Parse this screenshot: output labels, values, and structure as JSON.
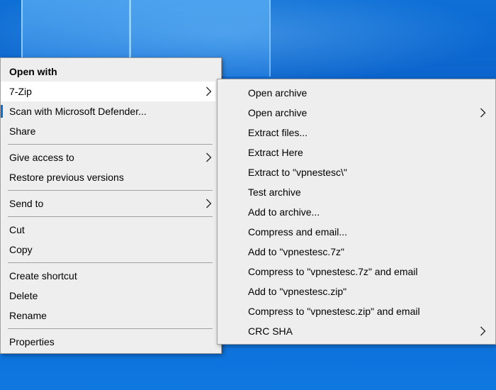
{
  "main_menu": {
    "items": [
      {
        "label": "Open with",
        "bold": true
      },
      {
        "label": "7-Zip",
        "submenu": true,
        "active": true
      },
      {
        "label": "Scan with Microsoft Defender...",
        "accent": true
      },
      {
        "label": "Share"
      },
      {
        "separator": true
      },
      {
        "label": "Give access to",
        "submenu": true
      },
      {
        "label": "Restore previous versions"
      },
      {
        "separator": true
      },
      {
        "label": "Send to",
        "submenu": true
      },
      {
        "separator": true
      },
      {
        "label": "Cut"
      },
      {
        "label": "Copy"
      },
      {
        "separator": true
      },
      {
        "label": "Create shortcut"
      },
      {
        "label": "Delete"
      },
      {
        "label": "Rename"
      },
      {
        "separator": true
      },
      {
        "label": "Properties"
      }
    ]
  },
  "sevenzip_menu": {
    "items": [
      {
        "label": "Open archive"
      },
      {
        "label": "Open archive",
        "submenu": true
      },
      {
        "label": "Extract files..."
      },
      {
        "label": "Extract Here"
      },
      {
        "label": "Extract to \"vpnestesc\\\""
      },
      {
        "label": "Test archive"
      },
      {
        "label": "Add to archive..."
      },
      {
        "label": "Compress and email..."
      },
      {
        "label": "Add to \"vpnestesc.7z\""
      },
      {
        "label": "Compress to \"vpnestesc.7z\" and email"
      },
      {
        "label": "Add to \"vpnestesc.zip\""
      },
      {
        "label": "Compress to \"vpnestesc.zip\" and email"
      },
      {
        "label": "CRC SHA",
        "submenu": true
      }
    ]
  },
  "colors": {
    "menu_bg": "#eeeeee",
    "hover_bg": "#ffffff",
    "separator": "#a0a0a0",
    "accent": "#0b6dd7",
    "desktop": "#0a5fc8"
  },
  "icons": {
    "submenu_arrow": "chevron-right-icon"
  }
}
